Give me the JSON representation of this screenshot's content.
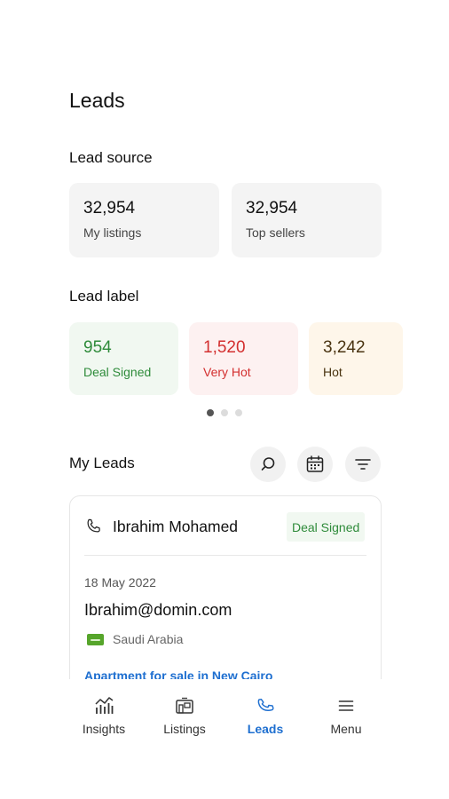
{
  "header": {
    "title": "Leads"
  },
  "lead_source": {
    "title": "Lead source",
    "cards": [
      {
        "value": "32,954",
        "label": "My listings"
      },
      {
        "value": "32,954",
        "label": "Top sellers"
      }
    ]
  },
  "lead_label": {
    "title": "Lead label",
    "cards": [
      {
        "value": "954",
        "label": "Deal Signed",
        "color": "#2e8b3a",
        "bg": "#f1f8f1"
      },
      {
        "value": "1,520",
        "label": "Very Hot",
        "color": "#d32f2f",
        "bg": "#fdf1f1"
      },
      {
        "value": "3,242",
        "label": "Hot",
        "color": "#4a3411",
        "bg": "#fef6ea"
      }
    ],
    "pager": {
      "pages": 3,
      "active": 1
    }
  },
  "my_leads": {
    "title": "My Leads",
    "actions": [
      "search-icon",
      "calendar-icon",
      "filter-icon"
    ],
    "lead": {
      "name": "Ibrahim Mohamed",
      "status": "Deal Signed",
      "date": "18 May 2022",
      "email": "Ibrahim@domin.com",
      "country": "Saudi Arabia",
      "listing": "Apartment for sale in New Cairo"
    }
  },
  "nav": {
    "items": [
      {
        "label": "Insights",
        "icon": "insights-icon"
      },
      {
        "label": "Listings",
        "icon": "listings-icon"
      },
      {
        "label": "Leads",
        "icon": "leads-icon",
        "active": true
      },
      {
        "label": "Menu",
        "icon": "menu-icon"
      }
    ]
  },
  "colors": {
    "accent": "#1e6fd0",
    "deal_signed": "#2e8b3a",
    "very_hot": "#d32f2f",
    "hot": "#4a3411"
  }
}
